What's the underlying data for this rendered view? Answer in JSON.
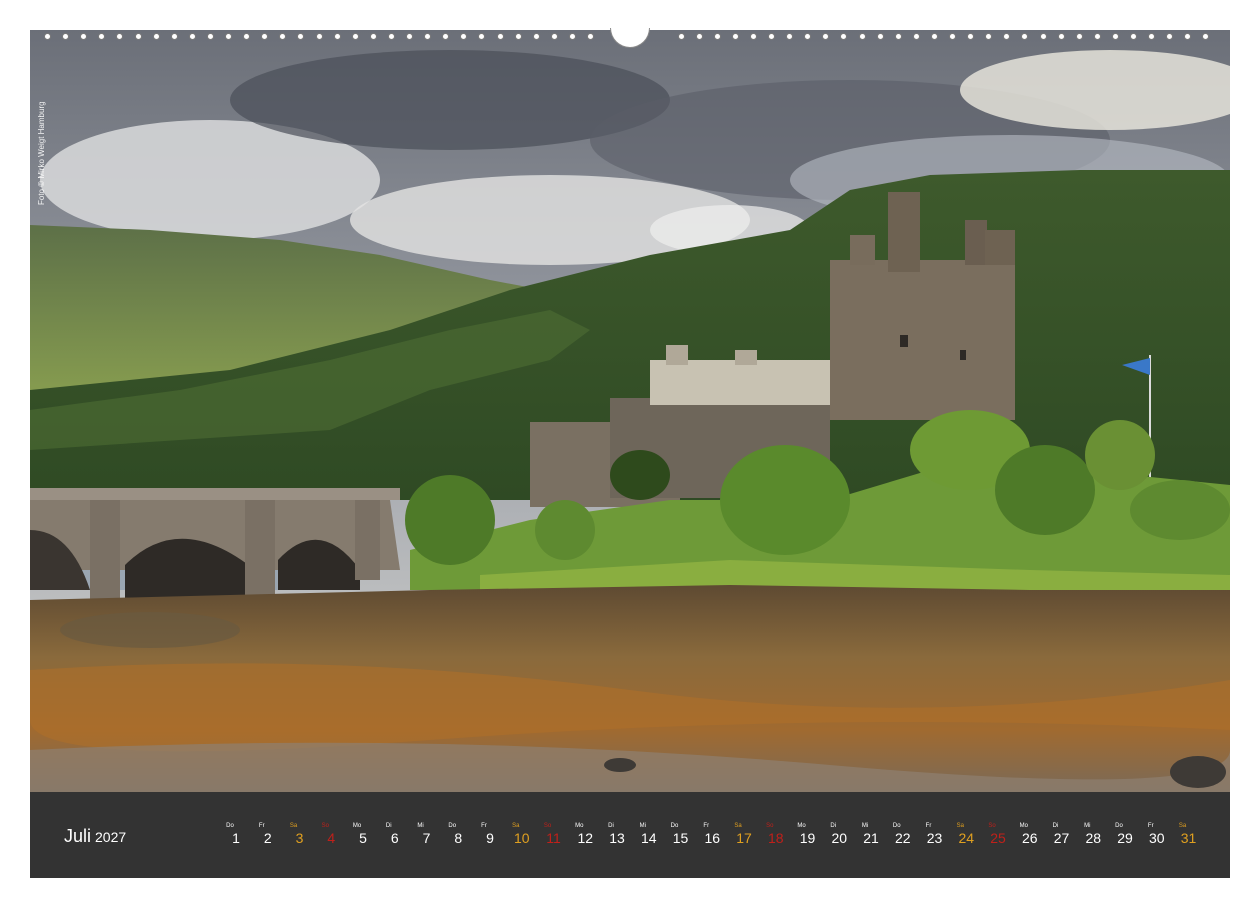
{
  "photo": {
    "credit": "Foto © Mirko Weigt Hamburg",
    "subject": "castle-on-loch-landscape"
  },
  "calendar": {
    "month": "Juli",
    "year": "2027",
    "colors": {
      "bar": "#333333",
      "weekday": "#ffffff",
      "saturday": "#e0a020",
      "sunday": "#c0201a"
    },
    "days": [
      {
        "wd": "Do",
        "n": "1",
        "type": "weekday"
      },
      {
        "wd": "Fr",
        "n": "2",
        "type": "weekday"
      },
      {
        "wd": "Sa",
        "n": "3",
        "type": "sat"
      },
      {
        "wd": "So",
        "n": "4",
        "type": "sun"
      },
      {
        "wd": "Mo",
        "n": "5",
        "type": "weekday"
      },
      {
        "wd": "Di",
        "n": "6",
        "type": "weekday"
      },
      {
        "wd": "Mi",
        "n": "7",
        "type": "weekday"
      },
      {
        "wd": "Do",
        "n": "8",
        "type": "weekday"
      },
      {
        "wd": "Fr",
        "n": "9",
        "type": "weekday"
      },
      {
        "wd": "Sa",
        "n": "10",
        "type": "sat"
      },
      {
        "wd": "So",
        "n": "11",
        "type": "sun"
      },
      {
        "wd": "Mo",
        "n": "12",
        "type": "weekday"
      },
      {
        "wd": "Di",
        "n": "13",
        "type": "weekday"
      },
      {
        "wd": "Mi",
        "n": "14",
        "type": "weekday"
      },
      {
        "wd": "Do",
        "n": "15",
        "type": "weekday"
      },
      {
        "wd": "Fr",
        "n": "16",
        "type": "weekday"
      },
      {
        "wd": "Sa",
        "n": "17",
        "type": "sat"
      },
      {
        "wd": "So",
        "n": "18",
        "type": "sun"
      },
      {
        "wd": "Mo",
        "n": "19",
        "type": "weekday"
      },
      {
        "wd": "Di",
        "n": "20",
        "type": "weekday"
      },
      {
        "wd": "Mi",
        "n": "21",
        "type": "weekday"
      },
      {
        "wd": "Do",
        "n": "22",
        "type": "weekday"
      },
      {
        "wd": "Fr",
        "n": "23",
        "type": "weekday"
      },
      {
        "wd": "Sa",
        "n": "24",
        "type": "sat"
      },
      {
        "wd": "So",
        "n": "25",
        "type": "sun"
      },
      {
        "wd": "Mo",
        "n": "26",
        "type": "weekday"
      },
      {
        "wd": "Di",
        "n": "27",
        "type": "weekday"
      },
      {
        "wd": "Mi",
        "n": "28",
        "type": "weekday"
      },
      {
        "wd": "Do",
        "n": "29",
        "type": "weekday"
      },
      {
        "wd": "Fr",
        "n": "30",
        "type": "weekday"
      },
      {
        "wd": "Sa",
        "n": "31",
        "type": "sat"
      }
    ]
  }
}
